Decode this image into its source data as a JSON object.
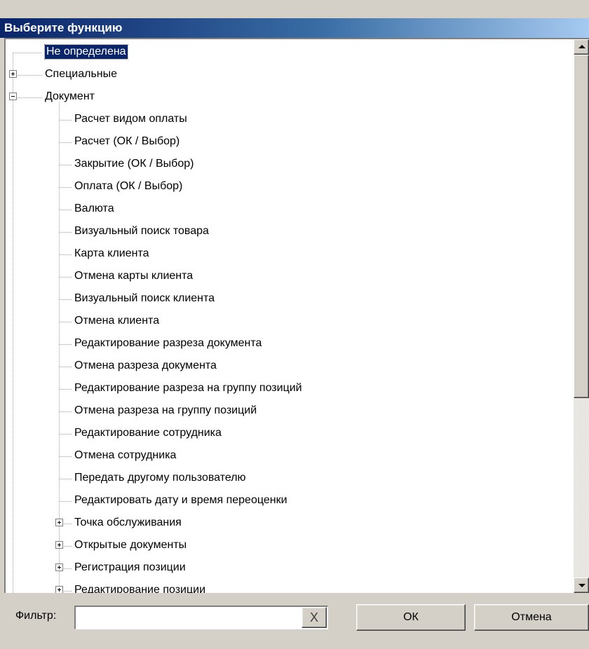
{
  "window": {
    "title": "Выберите функцию"
  },
  "tree": {
    "items": [
      {
        "label": "Не определена",
        "level": 0,
        "expander": "none",
        "selected": true
      },
      {
        "label": "Специальные",
        "level": 0,
        "expander": "plus"
      },
      {
        "label": "Документ",
        "level": 0,
        "expander": "minus"
      },
      {
        "label": "Расчет видом оплаты",
        "level": 1,
        "expander": "none"
      },
      {
        "label": "Расчет (ОК / Выбор)",
        "level": 1,
        "expander": "none"
      },
      {
        "label": "Закрытие (ОК / Выбор)",
        "level": 1,
        "expander": "none"
      },
      {
        "label": "Оплата (ОК / Выбор)",
        "level": 1,
        "expander": "none"
      },
      {
        "label": "Валюта",
        "level": 1,
        "expander": "none"
      },
      {
        "label": "Визуальный поиск товара",
        "level": 1,
        "expander": "none"
      },
      {
        "label": "Карта клиента",
        "level": 1,
        "expander": "none"
      },
      {
        "label": "Отмена карты клиента",
        "level": 1,
        "expander": "none"
      },
      {
        "label": "Визуальный поиск клиента",
        "level": 1,
        "expander": "none"
      },
      {
        "label": "Отмена клиента",
        "level": 1,
        "expander": "none"
      },
      {
        "label": "Редактирование разреза документа",
        "level": 1,
        "expander": "none"
      },
      {
        "label": "Отмена разреза документа",
        "level": 1,
        "expander": "none"
      },
      {
        "label": "Редактирование разреза на группу позиций",
        "level": 1,
        "expander": "none"
      },
      {
        "label": "Отмена разреза на группу позиций",
        "level": 1,
        "expander": "none"
      },
      {
        "label": "Редактирование сотрудника",
        "level": 1,
        "expander": "none"
      },
      {
        "label": "Отмена сотрудника",
        "level": 1,
        "expander": "none"
      },
      {
        "label": "Передать другому пользователю",
        "level": 1,
        "expander": "none"
      },
      {
        "label": "Редактировать дату и время переоценки",
        "level": 1,
        "expander": "none"
      },
      {
        "label": "Точка обслуживания",
        "level": 1,
        "expander": "plus"
      },
      {
        "label": "Открытые документы",
        "level": 1,
        "expander": "plus"
      },
      {
        "label": "Регистрация позиции",
        "level": 1,
        "expander": "plus"
      },
      {
        "label": "Редактирование позиции",
        "level": 1,
        "expander": "plus"
      }
    ],
    "scroll_position": 0.0
  },
  "filter": {
    "label": "Фильтр:",
    "value": "",
    "clear_label": "X"
  },
  "buttons": {
    "ok": "ОК",
    "cancel": "Отмена"
  },
  "colors": {
    "selection": "#0a246a",
    "title_start": "#0a246a",
    "title_end": "#a6caf0",
    "face": "#d4d0c8"
  }
}
